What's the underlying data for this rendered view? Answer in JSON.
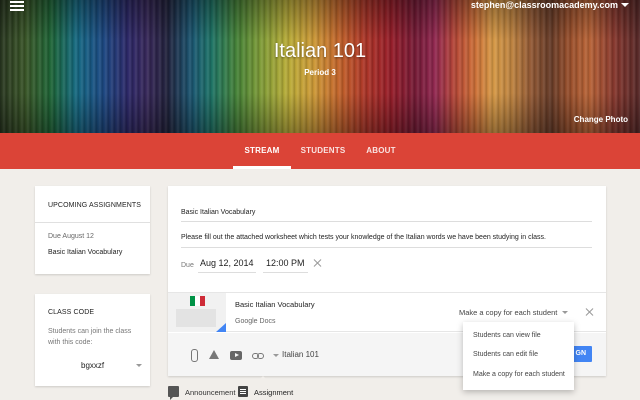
{
  "header": {
    "user_email": "stephen@classroomacademy.com",
    "class_title": "Italian 101",
    "class_period": "Period 3",
    "change_photo_label": "Change Photo"
  },
  "nav": {
    "tabs": [
      {
        "label": "STREAM",
        "active": true
      },
      {
        "label": "STUDENTS",
        "active": false
      },
      {
        "label": "ABOUT",
        "active": false
      }
    ]
  },
  "upcoming": {
    "heading": "UPCOMING ASSIGNMENTS",
    "due": "Due August 12",
    "item": "Basic Italian Vocabulary"
  },
  "class_code": {
    "heading": "CLASS CODE",
    "description": "Students can join the class with this code:",
    "code": "bgxxzf"
  },
  "composer": {
    "title_value": "Basic Italian Vocabulary",
    "description_value": "Please fill out the attached worksheet which tests your knowledge of the Italian words we have been studying in class.",
    "due_label": "Due",
    "due_date": "Aug 12, 2014",
    "due_time": "12:00 PM",
    "attachment": {
      "title": "Basic Italian Vocabulary",
      "subtitle": "Google Docs",
      "share_mode": "Make a copy for each student",
      "flag_colors": [
        "#009246",
        "#ffffff",
        "#ce2b37"
      ]
    },
    "class_select": "Italian 101",
    "assign_label": "GN"
  },
  "share_menu": {
    "options": [
      "Students can view file",
      "Students can edit file",
      "Make a copy for each student"
    ]
  },
  "post_type": {
    "announcement_label": "Announcement",
    "assignment_label": "Assignment"
  },
  "colors": {
    "accent_red": "#db4437",
    "assign_blue": "#4285f4",
    "background": "#f1eeea"
  }
}
